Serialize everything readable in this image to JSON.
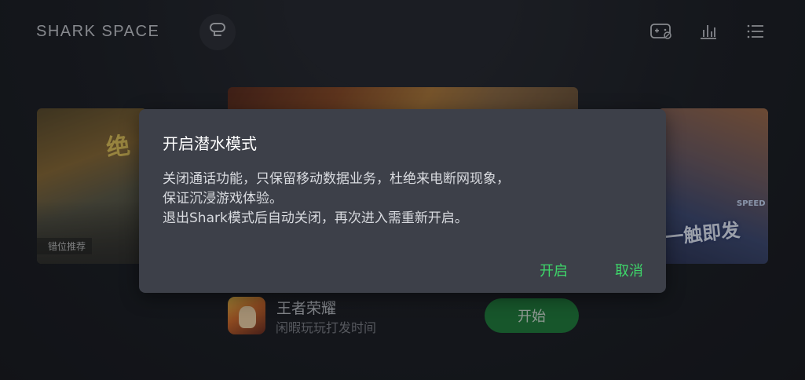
{
  "header": {
    "brand": "SHARK SPACE",
    "icons": [
      "shark-mode-icon",
      "gamepad-settings-icon",
      "bar-chart-icon",
      "list-menu-icon"
    ]
  },
  "carousel": {
    "left_card_title": "绝",
    "left_card_tag": "错位推荐",
    "right_card_title": "一触即发",
    "right_card_sub": "SPEED"
  },
  "game": {
    "name": "王者荣耀",
    "description": "闲暇玩玩打发时间",
    "start_label": "开始"
  },
  "dialog": {
    "title": "开启潜水模式",
    "body_lines": [
      "关闭通话功能，只保留移动数据业务，杜绝来电断网现象，",
      "保证沉浸游戏体验。",
      "退出Shark模式后自动关闭，再次进入需重新开启。"
    ],
    "confirm_label": "开启",
    "cancel_label": "取消"
  },
  "colors": {
    "background": "#1c1e24",
    "dialog": "#3d4049",
    "accent_green": "#3ed86a",
    "start_button": "#1f7f3b"
  }
}
